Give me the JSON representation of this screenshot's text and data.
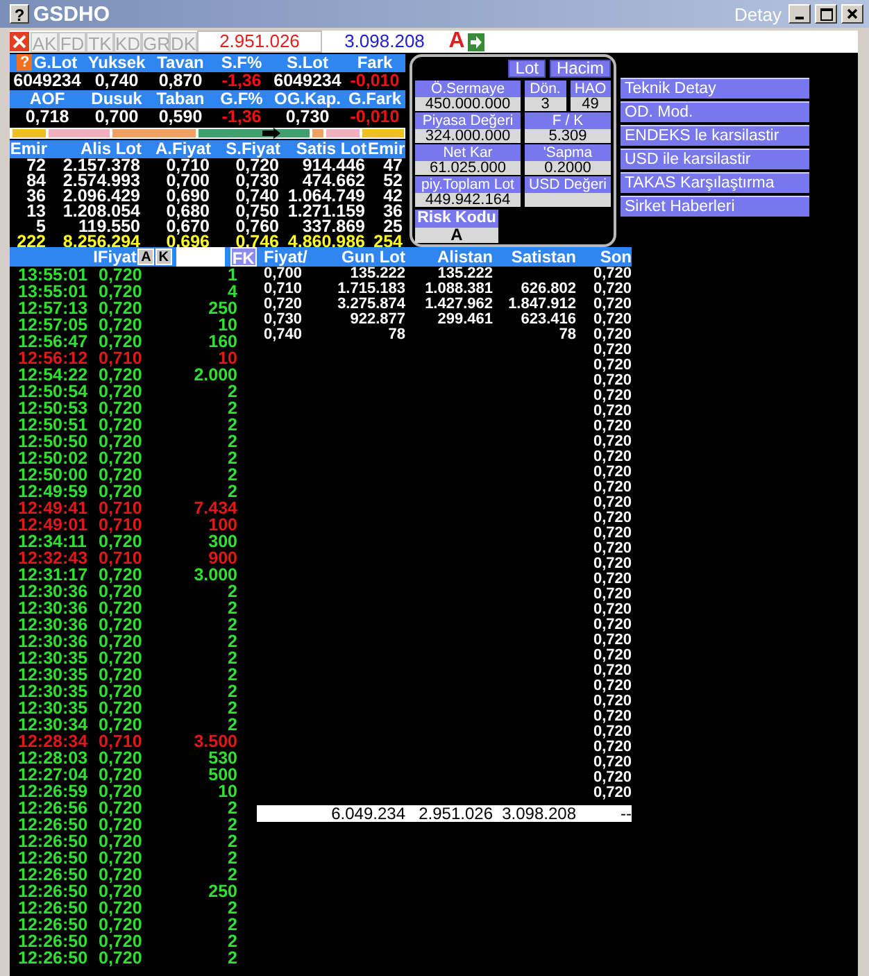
{
  "window": {
    "help": "?",
    "title": "GSDHO",
    "caption": "Detay"
  },
  "toolbar": {
    "buttons": [
      {
        "label": "AK",
        "disabled": true
      },
      {
        "label": "FD",
        "disabled": true
      },
      {
        "label": "TK",
        "disabled": true
      },
      {
        "label": "KD",
        "disabled": true
      },
      {
        "label": "GR",
        "disabled": true
      },
      {
        "label": "DK",
        "disabled": true
      }
    ],
    "value_1": "2.951.026",
    "value_2": "3.098.208",
    "flag": "A"
  },
  "stats": {
    "help": "?",
    "blocks": [
      {
        "labels": [
          "G.Lot",
          "Yuksek",
          "Tavan",
          "S.F%",
          "S.Lot",
          "Fark"
        ],
        "values": [
          {
            "text": "6049234",
            "negative": false
          },
          {
            "text": "0,740",
            "negative": false
          },
          {
            "text": "0,870",
            "negative": false
          },
          {
            "text": "-1,36",
            "negative": true
          },
          {
            "text": "6049234",
            "negative": false
          },
          {
            "text": "-0,010",
            "negative": true
          }
        ]
      },
      {
        "labels": [
          "AOF",
          "Dusuk",
          "Taban",
          "G.F%",
          "OG.Kap.",
          "G.Fark"
        ],
        "values": [
          {
            "text": "0,718",
            "negative": false
          },
          {
            "text": "0,700",
            "negative": false
          },
          {
            "text": "0,590",
            "negative": false
          },
          {
            "text": "-1,36",
            "negative": true
          },
          {
            "text": "0,730",
            "negative": false
          },
          {
            "text": "-0,010",
            "negative": true
          }
        ]
      }
    ]
  },
  "order_book": {
    "columns": [
      "Emir",
      "Alis Lot",
      "A.Fiyat",
      "S.Fiyat",
      "Satis Lot",
      "Emir"
    ],
    "rows": [
      {
        "cells": [
          "72",
          "2.157.378",
          "0,710",
          "0,720",
          "914.446",
          "47"
        ],
        "total": false
      },
      {
        "cells": [
          "84",
          "2.574.993",
          "0,700",
          "0,730",
          "474.662",
          "52"
        ],
        "total": false
      },
      {
        "cells": [
          "36",
          "2.096.429",
          "0,690",
          "0,740",
          "1.064.749",
          "42"
        ],
        "total": false
      },
      {
        "cells": [
          "13",
          "1.208.054",
          "0,680",
          "0,750",
          "1.271.159",
          "36"
        ],
        "total": false
      },
      {
        "cells": [
          "5",
          "119.550",
          "0,670",
          "0,760",
          "337.869",
          "25"
        ],
        "total": false
      },
      {
        "cells": [
          "222",
          "8.256.294",
          "0,696",
          "0,746",
          "4.860.986",
          "254"
        ],
        "total": true
      }
    ]
  },
  "info_panel": {
    "buttons": [
      "Lot",
      "Hacim"
    ],
    "rows": [
      {
        "left": {
          "label": "Ö.Sermaye",
          "value": "450.000.000"
        },
        "right": [
          {
            "label": "Dön.",
            "value": "3"
          },
          {
            "label": "HAO",
            "value": "49"
          }
        ]
      },
      {
        "left": {
          "label": "Piyasa Değeri",
          "value": "324.000.000"
        },
        "right": [
          {
            "label": "F / K",
            "value": "5.309"
          }
        ]
      },
      {
        "left": {
          "label": "Net Kar",
          "value": "61.025.000"
        },
        "right": [
          {
            "label": "'Sapma",
            "value": "0.2000"
          }
        ]
      },
      {
        "left": {
          "label": "piy.Toplam Lot",
          "value": "449.942.164"
        },
        "right": [
          {
            "label": "USD Değeri"
          }
        ]
      }
    ],
    "risk": {
      "label": "Risk Kodu",
      "value": "A"
    }
  },
  "links": [
    "Teknik Detay",
    "OD. Mod.",
    "ENDEKS le karsilastir",
    "USD ile karsilastir",
    "TAKAS Karşılaştırma",
    "Sirket Haberleri"
  ],
  "trades": {
    "header": "IFiyat",
    "buttons": [
      "A",
      "K"
    ],
    "fk": "FK",
    "rows": [
      {
        "time": "13:55:01",
        "price": "0,720",
        "volume": "1",
        "down": false
      },
      {
        "time": "13:55:01",
        "price": "0,720",
        "volume": "4",
        "down": false
      },
      {
        "time": "12:57:13",
        "price": "0,720",
        "volume": "250",
        "down": false
      },
      {
        "time": "12:57:05",
        "price": "0,720",
        "volume": "10",
        "down": false
      },
      {
        "time": "12:56:47",
        "price": "0,720",
        "volume": "160",
        "down": false
      },
      {
        "time": "12:56:12",
        "price": "0,710",
        "volume": "10",
        "down": true
      },
      {
        "time": "12:54:22",
        "price": "0,720",
        "volume": "2.000",
        "down": false
      },
      {
        "time": "12:50:54",
        "price": "0,720",
        "volume": "2",
        "down": false
      },
      {
        "time": "12:50:53",
        "price": "0,720",
        "volume": "2",
        "down": false
      },
      {
        "time": "12:50:51",
        "price": "0,720",
        "volume": "2",
        "down": false
      },
      {
        "time": "12:50:50",
        "price": "0,720",
        "volume": "2",
        "down": false
      },
      {
        "time": "12:50:02",
        "price": "0,720",
        "volume": "2",
        "down": false
      },
      {
        "time": "12:50:00",
        "price": "0,720",
        "volume": "2",
        "down": false
      },
      {
        "time": "12:49:59",
        "price": "0,720",
        "volume": "2",
        "down": false
      },
      {
        "time": "12:49:41",
        "price": "0,710",
        "volume": "7.434",
        "down": true
      },
      {
        "time": "12:49:01",
        "price": "0,710",
        "volume": "100",
        "down": true
      },
      {
        "time": "12:34:11",
        "price": "0,720",
        "volume": "300",
        "down": false
      },
      {
        "time": "12:32:43",
        "price": "0,710",
        "volume": "900",
        "down": true
      },
      {
        "time": "12:31:17",
        "price": "0,720",
        "volume": "3.000",
        "down": false
      },
      {
        "time": "12:30:36",
        "price": "0,720",
        "volume": "2",
        "down": false
      },
      {
        "time": "12:30:36",
        "price": "0,720",
        "volume": "2",
        "down": false
      },
      {
        "time": "12:30:36",
        "price": "0,720",
        "volume": "2",
        "down": false
      },
      {
        "time": "12:30:36",
        "price": "0,720",
        "volume": "2",
        "down": false
      },
      {
        "time": "12:30:35",
        "price": "0,720",
        "volume": "2",
        "down": false
      },
      {
        "time": "12:30:35",
        "price": "0,720",
        "volume": "2",
        "down": false
      },
      {
        "time": "12:30:35",
        "price": "0,720",
        "volume": "2",
        "down": false
      },
      {
        "time": "12:30:35",
        "price": "0,720",
        "volume": "2",
        "down": false
      },
      {
        "time": "12:30:34",
        "price": "0,720",
        "volume": "2",
        "down": false
      },
      {
        "time": "12:28:34",
        "price": "0,710",
        "volume": "3.500",
        "down": true
      },
      {
        "time": "12:28:03",
        "price": "0,720",
        "volume": "530",
        "down": false
      },
      {
        "time": "12:27:04",
        "price": "0,720",
        "volume": "500",
        "down": false
      },
      {
        "time": "12:26:59",
        "price": "0,720",
        "volume": "10",
        "down": false
      },
      {
        "time": "12:26:56",
        "price": "0,720",
        "volume": "2",
        "down": false
      },
      {
        "time": "12:26:50",
        "price": "0,720",
        "volume": "2",
        "down": false
      },
      {
        "time": "12:26:50",
        "price": "0,720",
        "volume": "2",
        "down": false
      },
      {
        "time": "12:26:50",
        "price": "0,720",
        "volume": "2",
        "down": false
      },
      {
        "time": "12:26:50",
        "price": "0,720",
        "volume": "2",
        "down": false
      },
      {
        "time": "12:26:50",
        "price": "0,720",
        "volume": "250",
        "down": false
      },
      {
        "time": "12:26:50",
        "price": "0,720",
        "volume": "2",
        "down": false
      },
      {
        "time": "12:26:50",
        "price": "0,720",
        "volume": "2",
        "down": false
      },
      {
        "time": "12:26:50",
        "price": "0,720",
        "volume": "2",
        "down": false
      },
      {
        "time": "12:26:50",
        "price": "0,720",
        "volume": "2",
        "down": false
      }
    ]
  },
  "price_table": {
    "columns": [
      "Fiyat/",
      "Gun Lot",
      "Alistan",
      "Satistan",
      "Son"
    ],
    "rows": [
      {
        "cells": [
          "0,700",
          "135.222",
          "135.222"
        ]
      },
      {
        "cells": [
          "0,710",
          "1.715.183",
          "1.088.381",
          "626.802"
        ]
      },
      {
        "cells": [
          "0,720",
          "3.275.874",
          "1.427.962",
          "1.847.912"
        ]
      },
      {
        "cells": [
          "0,730",
          "922.877",
          "299.461",
          "623.416"
        ]
      },
      {
        "cells": [
          "0,740",
          "78",
          "",
          "78"
        ]
      }
    ],
    "son": [
      "0,720",
      "0,720",
      "0,720",
      "0,720",
      "0,720",
      "0,720",
      "0,720",
      "0,720",
      "0,720",
      "0,720",
      "0,720",
      "0,720",
      "0,720",
      "0,720",
      "0,720",
      "0,720",
      "0,720",
      "0,720",
      "0,720",
      "0,720",
      "0,720",
      "0,720",
      "0,720",
      "0,720",
      "0,720",
      "0,720",
      "0,720",
      "0,720",
      "0,720",
      "0,720",
      "0,720",
      "0,720",
      "0,720",
      "0,720",
      "0,720"
    ],
    "totals": [
      "6.049.234",
      "2.951.026",
      "3.098.208",
      "--"
    ]
  }
}
